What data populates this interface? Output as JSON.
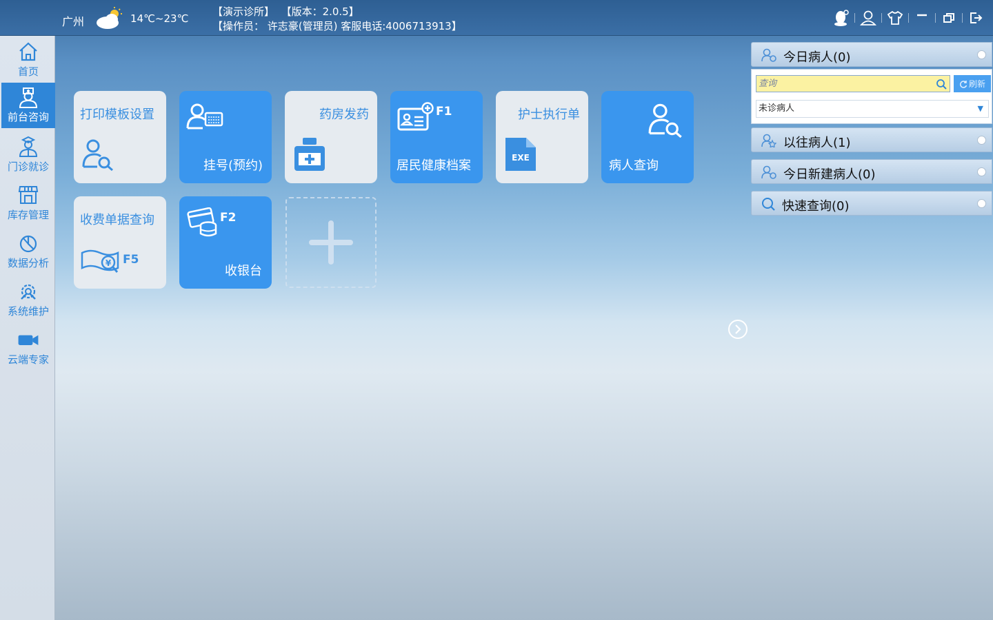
{
  "header": {
    "city": "广州",
    "temperature": "14℃~23℃",
    "clinic": "【演示诊所】",
    "version": "【版本：2.0.5】",
    "operator": "【操作员： 许志豪(管理员) 客服电话:4006713913】",
    "icons": [
      "qq-icon",
      "user-icon",
      "skin-icon",
      "minimize-icon",
      "restore-icon",
      "exit-icon"
    ]
  },
  "sidebar": {
    "items": [
      {
        "label": "首页",
        "icon": "home-icon"
      },
      {
        "label": "前台咨询",
        "icon": "nurse-icon",
        "active": true
      },
      {
        "label": "门诊就诊",
        "icon": "doctor-icon"
      },
      {
        "label": "库存管理",
        "icon": "store-icon"
      },
      {
        "label": "数据分析",
        "icon": "pie-chart-icon"
      },
      {
        "label": "系统维护",
        "icon": "tools-icon"
      },
      {
        "label": "云端专家",
        "icon": "video-icon"
      }
    ]
  },
  "tiles": [
    {
      "label": "打印模板设置",
      "style": "light",
      "icon": "user-search-icon"
    },
    {
      "label": "挂号(预约)",
      "style": "blue",
      "icon": "user-card-icon"
    },
    {
      "label": "药房发药",
      "style": "light",
      "icon": "medicine-bottle-icon"
    },
    {
      "label": "居民健康档案",
      "style": "blue",
      "icon": "id-card-plus-icon",
      "hotkey": "F1"
    },
    {
      "label": "护士执行单",
      "style": "light",
      "icon": "exe-file-icon"
    },
    {
      "label": "病人查询",
      "style": "blue",
      "icon": "user-search-icon"
    },
    {
      "label": "收费单据查询",
      "style": "light",
      "icon": "bill-search-icon",
      "hotkey": "F5"
    },
    {
      "label": "收银台",
      "style": "blue",
      "icon": "card-coins-icon",
      "hotkey": "F2"
    }
  ],
  "right_panel": {
    "today_patients": "今日病人(0)",
    "search_placeholder": "查询",
    "refresh_label": "刷新",
    "status_selected": "未诊病人",
    "past_patients": "以往病人(1)",
    "today_new_patients": "今日新建病人(0)",
    "quick_search": "快速查询(0)"
  },
  "colors": {
    "accent": "#3a96ee",
    "topbar": "#3b6fa6",
    "tile_light": "#e6ebf0"
  }
}
